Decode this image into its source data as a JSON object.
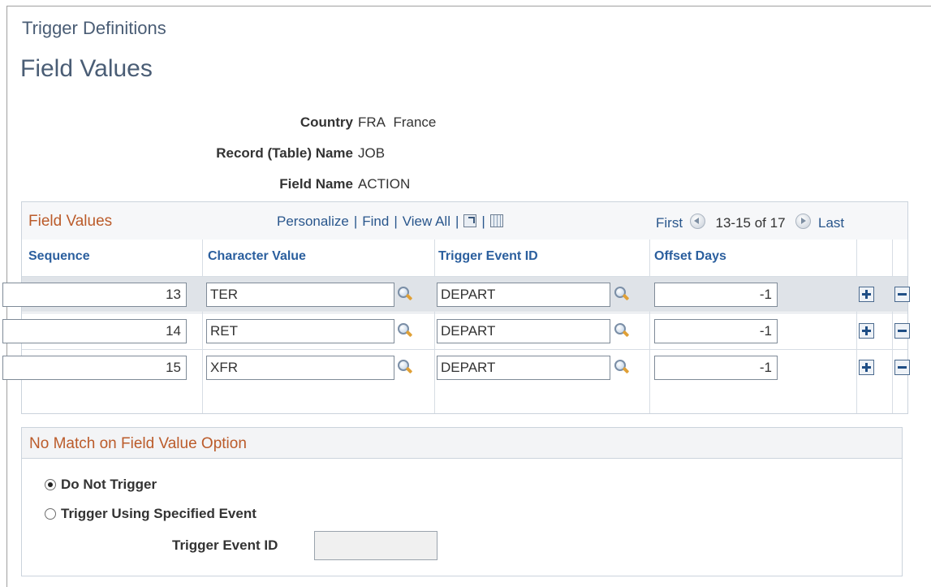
{
  "header": {
    "breadcrumb": "Trigger Definitions",
    "page_title": "Field Values"
  },
  "keys": {
    "country_label": "Country",
    "country_code": "FRA",
    "country_name": "France",
    "record_label": "Record (Table) Name",
    "record_value": "JOB",
    "field_label": "Field Name",
    "field_value": "ACTION"
  },
  "grid": {
    "title": "Field Values",
    "personalize": "Personalize",
    "find": "Find",
    "view_all": "View All",
    "sep": "|",
    "first": "First",
    "range": "13-15 of 17",
    "last": "Last",
    "columns": {
      "sequence": "Sequence",
      "character_value": "Character Value",
      "trigger_event_id": "Trigger Event ID",
      "offset_days": "Offset Days"
    },
    "rows": [
      {
        "sequence": "13",
        "character_value": "TER",
        "trigger_event_id": "DEPART",
        "offset_days": "-1",
        "selected": true
      },
      {
        "sequence": "14",
        "character_value": "RET",
        "trigger_event_id": "DEPART",
        "offset_days": "-1",
        "selected": false
      },
      {
        "sequence": "15",
        "character_value": "XFR",
        "trigger_event_id": "DEPART",
        "offset_days": "-1",
        "selected": false
      }
    ]
  },
  "no_match": {
    "title": "No Match on Field Value Option",
    "option_do_not_trigger": "Do Not Trigger",
    "option_trigger_specified": "Trigger Using Specified Event",
    "selected_option": "Do Not Trigger",
    "trigger_event_label": "Trigger Event ID",
    "trigger_event_value": ""
  },
  "icons": {
    "lookup": "lookup-magnifier-icon",
    "new_window": "new-window-icon",
    "spreadsheet": "spreadsheet-icon",
    "prev": "previous-arrow-icon",
    "next": "next-arrow-icon",
    "add_row": "add-row-icon",
    "delete_row": "delete-row-icon"
  },
  "colors": {
    "title_blue": "#4a5d75",
    "link_blue": "#29568c",
    "header_blue": "#2b5f9e",
    "section_orange": "#bb5b2a",
    "selected_row": "#dfe3e8"
  }
}
